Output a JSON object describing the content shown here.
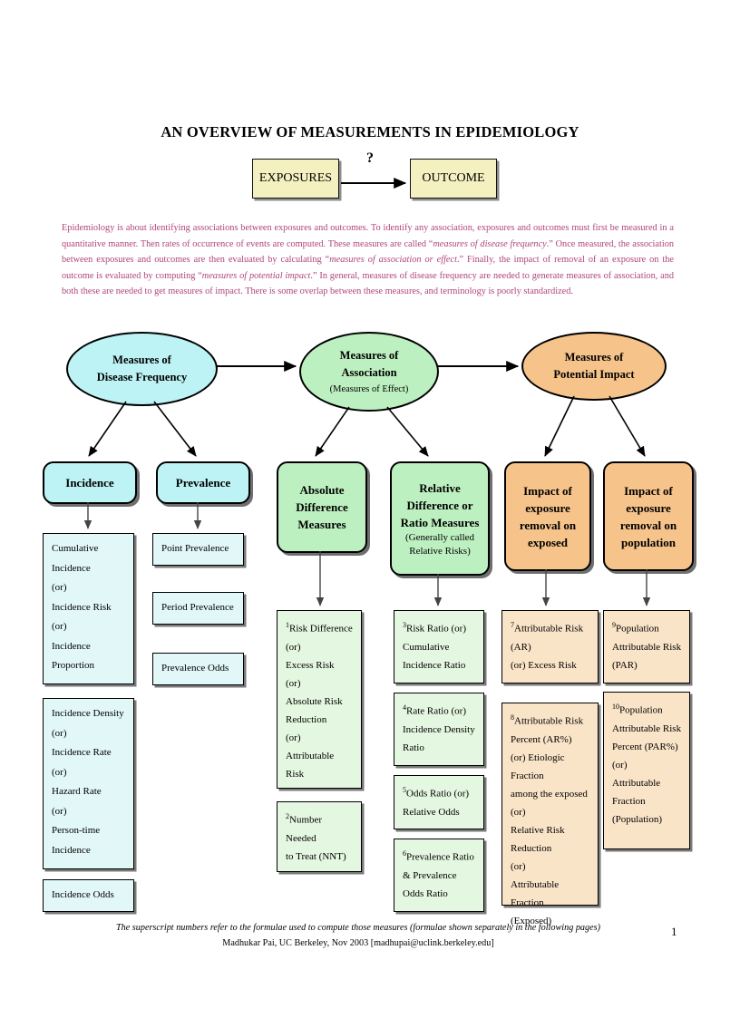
{
  "title": "AN OVERVIEW OF MEASUREMENTS IN EPIDEMIOLOGY",
  "top_flow": {
    "exposures": "EXPOSURES",
    "question_mark": "?",
    "outcome": "OUTCOME"
  },
  "intro_paragraph": {
    "part1": "Epidemiology is about identifying associations between exposures and outcomes. To identify any association, exposures and outcomes must first be measured in a quantitative manner. Then rates of occurrence of events are computed. These measures are called “",
    "em1": "measures of disease frequency",
    "part2": ".” Once measured, the association between exposures and outcomes are then evaluated by calculating “",
    "em2": "measures of association or effect",
    "part3": ".” Finally, the impact of removal of an exposure on the outcome is evaluated by computing “",
    "em3": "measures of potential impact",
    "part4": ".” In general, measures of disease frequency are needed to generate measures of association, and both these are needed to get measures of impact. There is some overlap between these measures, and terminology is poorly standardized."
  },
  "ellipses": [
    {
      "line1": "Measures of",
      "line2": "Disease Frequency",
      "sub": "",
      "color": "#bdf3f5"
    },
    {
      "line1": "Measures of",
      "line2": "Association",
      "sub": "(Measures of Effect)",
      "color": "#bdf0c0"
    },
    {
      "line1": "Measures of",
      "line2": "Potential Impact",
      "sub": "",
      "color": "#f6c38a"
    }
  ],
  "categories": [
    {
      "lines": [
        "Incidence"
      ],
      "sub": [],
      "color": "#bdf3f5"
    },
    {
      "lines": [
        "Prevalence"
      ],
      "sub": [],
      "color": "#bdf3f5"
    },
    {
      "lines": [
        "Absolute",
        "Difference",
        "Measures"
      ],
      "sub": [],
      "color": "#bdf0c0"
    },
    {
      "lines": [
        "Relative",
        "Difference or",
        "Ratio Measures"
      ],
      "sub": [
        "(Generally called",
        "Relative Risks)"
      ],
      "color": "#bdf0c0"
    },
    {
      "lines": [
        "Impact of",
        "exposure",
        "removal on",
        "exposed"
      ],
      "sub": [],
      "color": "#f6c38a"
    },
    {
      "lines": [
        "Impact of",
        "exposure",
        "removal on",
        "population"
      ],
      "sub": [],
      "color": "#f6c38a"
    }
  ],
  "leaf_boxes": {
    "incidence": [
      {
        "lines": [
          "Cumulative",
          "Incidence",
          "(or)",
          "Incidence Risk",
          "(or)",
          "Incidence",
          "Proportion"
        ]
      },
      {
        "lines": [
          "Incidence Density",
          "(or)",
          "Incidence Rate",
          "(or)",
          "Hazard Rate",
          "(or)",
          "Person-time",
          "Incidence"
        ]
      },
      {
        "lines": [
          "Incidence Odds"
        ]
      }
    ],
    "prevalence": [
      {
        "lines": [
          "Point Prevalence"
        ]
      },
      {
        "lines": [
          "Period Prevalence"
        ]
      },
      {
        "lines": [
          "Prevalence Odds"
        ]
      }
    ],
    "absolute": [
      {
        "sup": "1",
        "lines": [
          "Risk Difference",
          "(or)",
          "Excess Risk",
          "(or)",
          "Absolute Risk",
          "Reduction",
          "(or)",
          "Attributable Risk"
        ]
      },
      {
        "sup": "2",
        "lines": [
          "Number Needed",
          "to Treat (NNT)"
        ]
      }
    ],
    "relative": [
      {
        "sup": "3",
        "lines": [
          "Risk Ratio (or)",
          "Cumulative",
          "Incidence Ratio"
        ]
      },
      {
        "sup": "4",
        "lines": [
          "Rate Ratio (or)",
          "Incidence Density",
          "Ratio"
        ]
      },
      {
        "sup": "5",
        "lines": [
          "Odds Ratio (or)",
          "Relative Odds"
        ]
      },
      {
        "sup": "6",
        "lines": [
          "Prevalence Ratio",
          "& Prevalence",
          "Odds Ratio"
        ]
      }
    ],
    "impact_exposed": [
      {
        "sup": "7",
        "lines": [
          "Attributable Risk",
          "(AR)",
          "(or) Excess Risk"
        ]
      },
      {
        "sup": "8",
        "lines": [
          "Attributable Risk",
          "Percent (AR%)",
          "(or) Etiologic Fraction",
          "among the exposed",
          "(or)",
          "Relative Risk",
          "Reduction",
          "(or)",
          "Attributable Fraction",
          "(Exposed)"
        ]
      }
    ],
    "impact_population": [
      {
        "sup": "9",
        "lines": [
          "Population",
          "Attributable Risk",
          "(PAR)"
        ]
      },
      {
        "sup": "10",
        "lines": [
          "Population",
          "Attributable Risk",
          "Percent (PAR%)",
          "(or)",
          "Attributable",
          "Fraction",
          "(Population)"
        ]
      }
    ]
  },
  "footer": {
    "note": "The superscript numbers refer to the formulae used to compute those measures (formulae shown separately in the following pages)",
    "credit": "Madhukar Pai, UC Berkeley, Nov 2003 [madhupai@uclink.berkeley.edu]",
    "page_number": "1"
  },
  "colors": {
    "paragraph_text": "#b0447a",
    "cyan_fill": "#bdf3f5",
    "green_fill": "#bdf0c0",
    "orange_fill": "#f6c38a",
    "yellow_fill": "#f5f0c0"
  }
}
